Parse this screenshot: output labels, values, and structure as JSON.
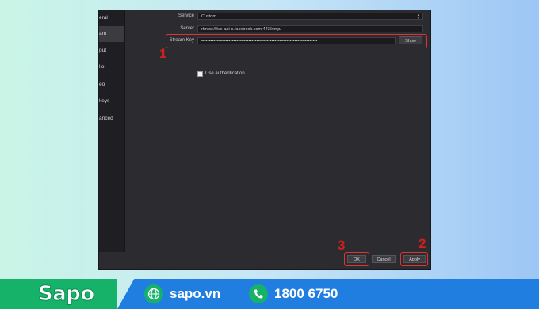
{
  "sidebar": {
    "items": [
      {
        "label": "eral"
      },
      {
        "label": "am"
      },
      {
        "label": "put"
      },
      {
        "label": "lio"
      },
      {
        "label": "eo"
      },
      {
        "label": "keys"
      },
      {
        "label": "anced"
      }
    ]
  },
  "stream": {
    "service_label": "Service",
    "service_value": "Custom...",
    "server_label": "Server",
    "server_value": "rtmps://live-api-s.facebook.com:443/rtmp/",
    "key_label": "Stream Key",
    "key_value": "••••••••••••••••••••••••••••••••••••••••••••••••••••••••••••••••••••••••••••",
    "show_button": "Show",
    "use_auth_label": "Use authentication"
  },
  "footer": {
    "ok_label": "OK",
    "cancel_label": "Cancel",
    "apply_label": "Apply"
  },
  "markers": {
    "one": "1",
    "two": "2",
    "three": "3"
  },
  "branding": {
    "logo": "Sapo",
    "website": "sapo.vn",
    "phone": "1800 6750"
  },
  "colors": {
    "highlight": "#e23333",
    "brand_green": "#17b26a",
    "brand_blue": "#1f7ee0"
  }
}
